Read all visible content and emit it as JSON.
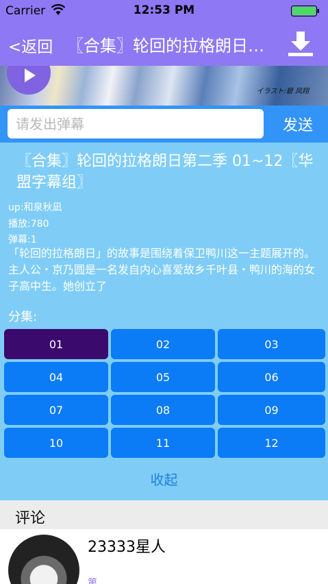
{
  "status_bar": {
    "carrier": "Carrier",
    "time": "12:53 PM"
  },
  "nav": {
    "back_label": "<返回",
    "title": "〖合集〗轮回的拉格朗日第二季 01~12〖华盟字幕组〗",
    "download_icon": "download-icon"
  },
  "banner": {
    "credit": "イラスト:碧 凤翔"
  },
  "danmu": {
    "placeholder": "请发出弹幕",
    "send_label": "发送"
  },
  "video": {
    "title": "〖合集〗轮回的拉格朗日第二季 01~12〖华盟字幕组〗",
    "uploader": "up:和泉秋凪",
    "plays": "播放:780",
    "danmaku": "弹幕:1",
    "description": "「轮回的拉格朗日」的故事是围绕着保卫鸭川这一主题展开的。主人公・京乃圆是一名发自内心喜爱故乡千叶县・鸭川的海的女子高中生。她创立了"
  },
  "episodes": {
    "label": "分集:",
    "items": [
      "01",
      "02",
      "03",
      "04",
      "05",
      "06",
      "07",
      "08",
      "09",
      "10",
      "11",
      "12"
    ],
    "selected": "01",
    "collapse_label": "收起"
  },
  "comments": {
    "header": "评论",
    "items": [
      {
        "username": "23333星人",
        "snippet": "第"
      }
    ]
  },
  "colors": {
    "nav": "#8f78f3",
    "input_bar": "#3394f7",
    "info_bg": "#7fcdf7",
    "episode": "#0b7bf6",
    "episode_active": "#3a0a6d"
  }
}
